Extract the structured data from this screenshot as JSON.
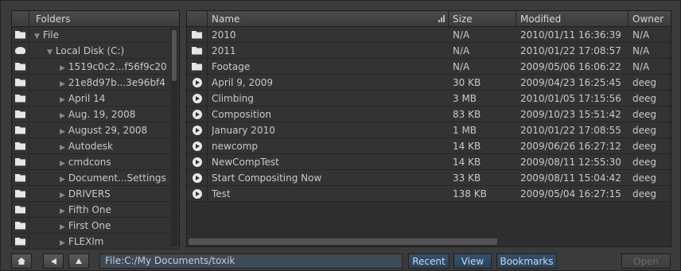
{
  "folders_panel": {
    "header": "Folders",
    "items": [
      {
        "label": "File",
        "level": 0,
        "expanded": true,
        "icon": "folder-icon"
      },
      {
        "label": "Local Disk (C:)",
        "level": 1,
        "expanded": true,
        "icon": "disk-icon"
      },
      {
        "label": "1519c0c2...f56f9c20",
        "level": 2,
        "expanded": false,
        "icon": "folder-icon"
      },
      {
        "label": "21e8d97b...3e96bf4",
        "level": 2,
        "expanded": false,
        "icon": "folder-icon"
      },
      {
        "label": "April 14",
        "level": 2,
        "expanded": false,
        "icon": "folder-icon"
      },
      {
        "label": "Aug. 19, 2008",
        "level": 2,
        "expanded": false,
        "icon": "folder-icon"
      },
      {
        "label": "August 29, 2008",
        "level": 2,
        "expanded": false,
        "icon": "folder-icon"
      },
      {
        "label": "Autodesk",
        "level": 2,
        "expanded": false,
        "icon": "folder-icon"
      },
      {
        "label": "cmdcons",
        "level": 2,
        "expanded": false,
        "icon": "folder-icon"
      },
      {
        "label": "Document...Settings",
        "level": 2,
        "expanded": false,
        "icon": "folder-icon"
      },
      {
        "label": "DRIVERS",
        "level": 2,
        "expanded": false,
        "icon": "folder-icon"
      },
      {
        "label": "Fifth One",
        "level": 2,
        "expanded": false,
        "icon": "folder-icon"
      },
      {
        "label": "First One",
        "level": 2,
        "expanded": false,
        "icon": "folder-icon"
      },
      {
        "label": "FLEXlm",
        "level": 2,
        "expanded": false,
        "icon": "folder-icon"
      }
    ]
  },
  "files_panel": {
    "columns": {
      "name": "Name",
      "size": "Size",
      "modified": "Modified",
      "owner": "Owner"
    },
    "rows": [
      {
        "name": "2010",
        "size": "N/A",
        "modified": "2010/01/11 16:36:39",
        "owner": "N/A",
        "icon": "folder-icon"
      },
      {
        "name": "2011",
        "size": "N/A",
        "modified": "2010/01/22 17:08:57",
        "owner": "N/A",
        "icon": "folder-icon"
      },
      {
        "name": "Footage",
        "size": "N/A",
        "modified": "2009/05/06 16:06:22",
        "owner": "N/A",
        "icon": "folder-icon"
      },
      {
        "name": "April 9, 2009",
        "size": "30 KB",
        "modified": "2009/04/23 16:25:45",
        "owner": "deeg",
        "icon": "play-icon"
      },
      {
        "name": "Climbing",
        "size": "3 MB",
        "modified": "2010/01/05 17:15:56",
        "owner": "deeg",
        "icon": "play-icon"
      },
      {
        "name": "Composition",
        "size": "83 KB",
        "modified": "2009/10/23 15:51:42",
        "owner": "deeg",
        "icon": "play-icon"
      },
      {
        "name": "January 2010",
        "size": "1 MB",
        "modified": "2010/01/22 17:08:55",
        "owner": "deeg",
        "icon": "play-icon"
      },
      {
        "name": "newcomp",
        "size": "14 KB",
        "modified": "2009/06/26 16:27:12",
        "owner": "deeg",
        "icon": "play-icon"
      },
      {
        "name": "NewCompTest",
        "size": "14 KB",
        "modified": "2009/08/11 12:55:30",
        "owner": "deeg",
        "icon": "play-icon"
      },
      {
        "name": "Start Compositing Now",
        "size": "33 KB",
        "modified": "2009/08/11 15:04:42",
        "owner": "deeg",
        "icon": "play-icon"
      },
      {
        "name": "Test",
        "size": "138 KB",
        "modified": "2009/05/04 16:27:15",
        "owner": "deeg",
        "icon": "play-icon"
      }
    ]
  },
  "bottom_bar": {
    "path": "File:C:/My Documents/toxik",
    "recent_label": "Recent",
    "view_label": "View",
    "bookmarks_label": "Bookmarks",
    "open_label": "Open"
  }
}
